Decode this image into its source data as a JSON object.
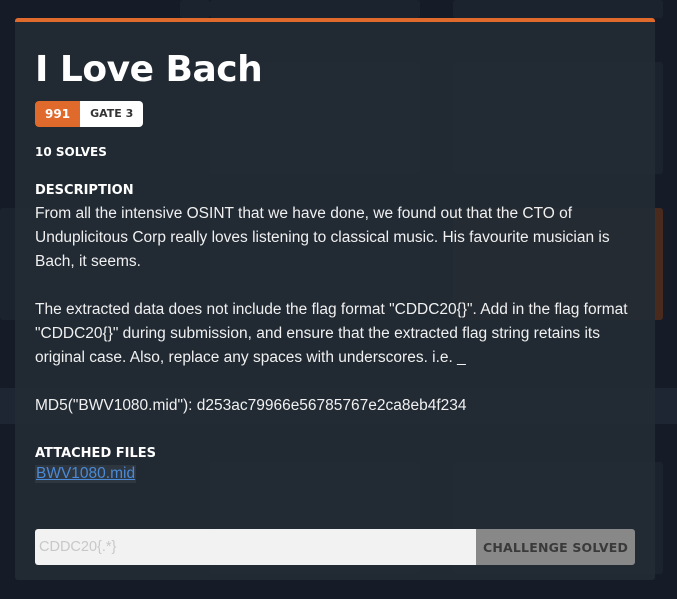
{
  "modal": {
    "title": "I Love Bach",
    "points": "991",
    "gate": "GATE 3",
    "solves": "10 SOLVES",
    "description_label": "DESCRIPTION",
    "description": [
      "From all the intensive OSINT that we have done, we found out that the CTO of Unduplicitous Corp really loves listening to classical music. His favourite musician is Bach, it seems.",
      "The extracted data does not include the flag format \"CDDC20{}\". Add in the flag format \"CDDC20{}\" during submission, and ensure that the extracted flag string retains its original case. Also, replace any spaces with underscores. i.e. _",
      "MD5(\"BWV1080.mid\"): d253ac79966e56785767e2ca8eb4f234"
    ],
    "attached_files_label": "ATTACHED FILES",
    "files": [
      "BWV1080.mid"
    ],
    "flag_placeholder": "CDDC20{.*}",
    "submit_label": "CHALLENGE SOLVED"
  },
  "colors": {
    "accent": "#e06a2c",
    "link": "#4a8ad8",
    "button_disabled": "#888888"
  }
}
